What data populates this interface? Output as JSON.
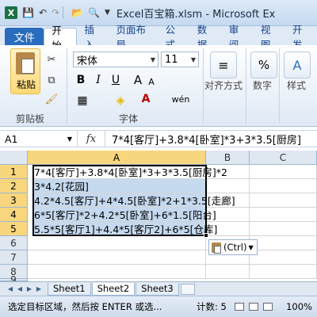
{
  "titlebar": {
    "app_icon": "excel-logo-icon",
    "quick_access": [
      "save-icon",
      "undo-icon",
      "redo-icon",
      "open-folder-icon",
      "print-preview-icon"
    ],
    "title": "Excel百宝箱.xlsm - Microsoft Ex"
  },
  "tabs": {
    "file": "文件",
    "items": [
      "开始",
      "插入",
      "页面布局",
      "公式",
      "数据",
      "审阅",
      "视图",
      "开发"
    ],
    "active": "开始"
  },
  "ribbon": {
    "clipboard": {
      "paste_label": "粘贴",
      "group_label": "剪贴板"
    },
    "font": {
      "font_name": "宋体",
      "font_size": "11",
      "group_label": "字体",
      "bold": "B",
      "italic": "I",
      "underline": "U",
      "grow": "A",
      "shrink": "A"
    },
    "alignment": {
      "label": "对齐方式"
    },
    "number": {
      "label": "数字"
    },
    "styles": {
      "label": "样式"
    }
  },
  "formula_bar": {
    "name_box": "A1",
    "fx": "fx",
    "content": "7*4[客厅]+3.8*4[卧室]*3+3*3.5[厨房]"
  },
  "grid": {
    "columns": [
      "A",
      "B",
      "C"
    ],
    "rows": [
      "1",
      "2",
      "3",
      "4",
      "5",
      "6",
      "7",
      "8",
      "9"
    ],
    "cells": [
      "7*4[客厅]+3.8*4[卧室]*3+3*3.5[厨房]*2",
      "3*4.2[花园]",
      "4.2*4.5[客厅]+4*4.5[卧室]*2+1*3.5[走廊]",
      "6*5[客厅]*2+4.2*5[卧室]+6*1.5[阳台]",
      "5.5*5[客厅1]+4.4*5[客厅2]+6*5[仓库]"
    ],
    "paste_options": "(Ctrl)"
  },
  "sheets": {
    "tabs": [
      "Sheet1",
      "Sheet2",
      "Sheet3"
    ],
    "active": "Sheet2"
  },
  "status": {
    "message": "选定目标区域，然后按 ENTER 或选...",
    "count": "计数: 5",
    "zoom": "100%"
  }
}
